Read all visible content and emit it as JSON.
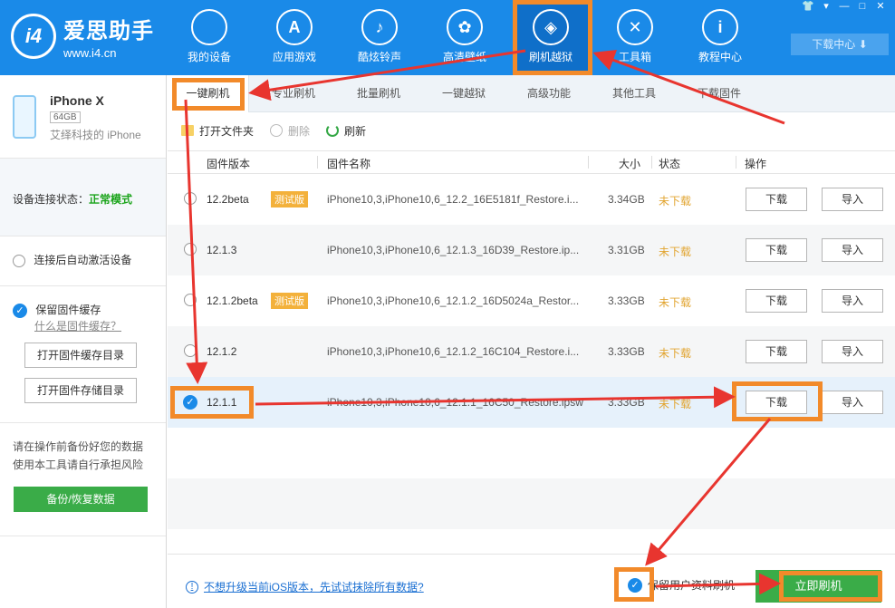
{
  "app": {
    "logo_mark": "i4",
    "title": "爱思助手",
    "url": "www.i4.cn"
  },
  "nav": [
    {
      "label": "我的设备",
      "icon": "apple-icon",
      "glyph": ""
    },
    {
      "label": "应用游戏",
      "icon": "app-store-icon",
      "glyph": "A"
    },
    {
      "label": "酷炫铃声",
      "icon": "bell-icon",
      "glyph": "♪"
    },
    {
      "label": "高清壁纸",
      "icon": "flower-icon",
      "glyph": "✿"
    },
    {
      "label": "刷机越狱",
      "icon": "box-icon",
      "glyph": "◈"
    },
    {
      "label": "工具箱",
      "icon": "tools-icon",
      "glyph": "✕"
    },
    {
      "label": "教程中心",
      "icon": "info-icon",
      "glyph": "i"
    }
  ],
  "window_controls": [
    "👕",
    "▾",
    "—",
    "□",
    "✕"
  ],
  "download_center": "下载中心 ⬇",
  "device": {
    "name": "iPhone X",
    "capacity": "64GB",
    "owner": "艾绎科技的 iPhone"
  },
  "sidebar": {
    "status_label": "设备连接状态：",
    "status_value": "正常模式",
    "auto_activate": "连接后自动激活设备",
    "keep_firmware": "保留固件缓存",
    "what_is_cache": "什么是固件缓存？",
    "open_cache_dir": "打开固件缓存目录",
    "open_storage_dir": "打开固件存储目录",
    "warning_line1": "请在操作前备份好您的数据",
    "warning_line2": "使用本工具请自行承担风险",
    "backup_button": "备份/恢复数据"
  },
  "tabs": [
    "一键刷机",
    "专业刷机",
    "批量刷机",
    "一键越狱",
    "高级功能",
    "其他工具",
    "下载固件"
  ],
  "toolbar": {
    "open_folder": "打开文件夹",
    "delete": "删除",
    "refresh": "刷新"
  },
  "table": {
    "headers": {
      "version": "固件版本",
      "name": "固件名称",
      "size": "大小",
      "status": "状态",
      "action": "操作"
    },
    "rows": [
      {
        "version": "12.2beta",
        "beta": "测试版",
        "name": "iPhone10,3,iPhone10,6_12.2_16E5181f_Restore.i...",
        "size": "3.34GB",
        "status": "未下载",
        "download": "下载",
        "import": "导入"
      },
      {
        "version": "12.1.3",
        "beta": "",
        "name": "iPhone10,3,iPhone10,6_12.1.3_16D39_Restore.ip...",
        "size": "3.31GB",
        "status": "未下载",
        "download": "下载",
        "import": "导入"
      },
      {
        "version": "12.1.2beta",
        "beta": "测试版",
        "name": "iPhone10,3,iPhone10,6_12.1.2_16D5024a_Restor...",
        "size": "3.33GB",
        "status": "未下载",
        "download": "下载",
        "import": "导入"
      },
      {
        "version": "12.1.2",
        "beta": "",
        "name": "iPhone10,3,iPhone10,6_12.1.2_16C104_Restore.i...",
        "size": "3.33GB",
        "status": "未下载",
        "download": "下载",
        "import": "导入"
      },
      {
        "version": "12.1.1",
        "beta": "",
        "name": "iPhone10,3,iPhone10,6_12.1.1_16C50_Restore.ipsw",
        "size": "3.33GB",
        "status": "未下载",
        "download": "下载",
        "import": "导入",
        "selected": true
      }
    ]
  },
  "footer": {
    "help_text": "不想升级当前iOS版本，先试试抹除所有数据?",
    "keep_data": "保留用户资料刷机",
    "flash_button": "立即刷机"
  },
  "colors": {
    "brand_blue": "#1a8ae8",
    "green": "#3aac48",
    "highlight_orange": "#f28a2a",
    "arrow_red": "#e8352f"
  }
}
